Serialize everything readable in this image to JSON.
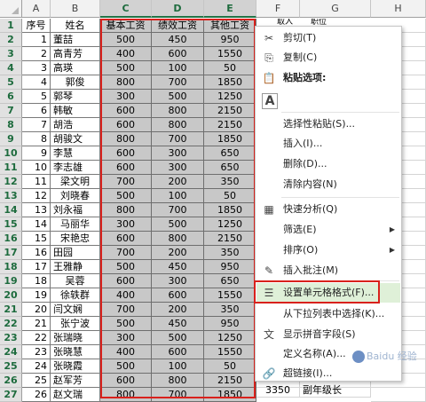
{
  "columns": [
    "A",
    "B",
    "C",
    "D",
    "E",
    "F",
    "G",
    "H"
  ],
  "headers": {
    "seq": "序号",
    "name": "姓名",
    "base": "基本工资",
    "perf": "绩效工资",
    "other": "其他工资"
  },
  "rows": [
    {
      "seq": "1",
      "name": "董喆",
      "base": "500",
      "perf": "450",
      "other": "950"
    },
    {
      "seq": "2",
      "name": "高青芳",
      "base": "400",
      "perf": "600",
      "other": "1550"
    },
    {
      "seq": "3",
      "name": "高瑛",
      "base": "500",
      "perf": "100",
      "other": "50"
    },
    {
      "seq": "4",
      "name": "郭俊",
      "base": "800",
      "perf": "700",
      "other": "1850"
    },
    {
      "seq": "5",
      "name": "郭琴",
      "base": "300",
      "perf": "500",
      "other": "1250"
    },
    {
      "seq": "6",
      "name": "韩敏",
      "base": "600",
      "perf": "800",
      "other": "2150"
    },
    {
      "seq": "7",
      "name": "胡浩",
      "base": "600",
      "perf": "800",
      "other": "2150"
    },
    {
      "seq": "8",
      "name": "胡骏文",
      "base": "800",
      "perf": "700",
      "other": "1850"
    },
    {
      "seq": "9",
      "name": "李慧",
      "base": "600",
      "perf": "300",
      "other": "650"
    },
    {
      "seq": "10",
      "name": "李志雄",
      "base": "600",
      "perf": "300",
      "other": "650"
    },
    {
      "seq": "11",
      "name": "梁文明",
      "base": "700",
      "perf": "200",
      "other": "350"
    },
    {
      "seq": "12",
      "name": "刘晓春",
      "base": "500",
      "perf": "100",
      "other": "50"
    },
    {
      "seq": "13",
      "name": "刘永福",
      "base": "800",
      "perf": "700",
      "other": "1850"
    },
    {
      "seq": "14",
      "name": "马丽华",
      "base": "300",
      "perf": "500",
      "other": "1250"
    },
    {
      "seq": "15",
      "name": "宋艳忠",
      "base": "600",
      "perf": "800",
      "other": "2150"
    },
    {
      "seq": "16",
      "name": "田园",
      "base": "700",
      "perf": "200",
      "other": "350"
    },
    {
      "seq": "17",
      "name": "王雅静",
      "base": "500",
      "perf": "450",
      "other": "950"
    },
    {
      "seq": "18",
      "name": "吴蓉",
      "base": "600",
      "perf": "300",
      "other": "650"
    },
    {
      "seq": "19",
      "name": "徐轶群",
      "base": "400",
      "perf": "600",
      "other": "1550"
    },
    {
      "seq": "20",
      "name": "闫文娴",
      "base": "700",
      "perf": "200",
      "other": "350"
    },
    {
      "seq": "21",
      "name": "张宁波",
      "base": "500",
      "perf": "450",
      "other": "950"
    },
    {
      "seq": "22",
      "name": "张瑞晓",
      "base": "300",
      "perf": "500",
      "other": "1250"
    },
    {
      "seq": "23",
      "name": "张晓慧",
      "base": "400",
      "perf": "600",
      "other": "1550"
    },
    {
      "seq": "24",
      "name": "张晓霞",
      "base": "500",
      "perf": "100",
      "other": "50"
    },
    {
      "seq": "25",
      "name": "赵军芳",
      "base": "600",
      "perf": "800",
      "other": "2150"
    },
    {
      "seq": "26",
      "name": "赵文瑞",
      "base": "800",
      "perf": "700",
      "other": "1850"
    }
  ],
  "partial_cells": {
    "f1": "取入",
    "g1": "职位",
    "f27": "3350",
    "g27": "副年级长"
  },
  "context_menu": {
    "items": [
      {
        "key": "cut",
        "label": "剪切(T)",
        "icon": "scissors-icon",
        "glyph": "✂"
      },
      {
        "key": "copy",
        "label": "复制(C)",
        "icon": "copy-icon",
        "glyph": "⎘"
      },
      {
        "key": "paste_options",
        "label": "粘贴选项:",
        "icon": "paste-icon",
        "glyph": "📋",
        "bold": true
      },
      {
        "key": "paste_a",
        "label": "",
        "icon": "paste-text-icon",
        "glyph": "A"
      },
      {
        "key": "paste_special",
        "label": "选择性粘贴(S)...",
        "icon": "",
        "glyph": ""
      },
      {
        "key": "insert",
        "label": "插入(I)...",
        "icon": "",
        "glyph": ""
      },
      {
        "key": "delete",
        "label": "删除(D)...",
        "icon": "",
        "glyph": ""
      },
      {
        "key": "clear",
        "label": "清除内容(N)",
        "icon": "",
        "glyph": ""
      },
      {
        "key": "quick_analysis",
        "label": "快速分析(Q)",
        "icon": "quick-analysis-icon",
        "glyph": "▦"
      },
      {
        "key": "filter",
        "label": "筛选(E)",
        "icon": "",
        "glyph": "",
        "submenu": true
      },
      {
        "key": "sort",
        "label": "排序(O)",
        "icon": "",
        "glyph": "",
        "submenu": true
      },
      {
        "key": "insert_comment",
        "label": "插入批注(M)",
        "icon": "comment-icon",
        "glyph": "✎"
      },
      {
        "key": "format_cells",
        "label": "设置单元格格式(F)...",
        "icon": "format-cells-icon",
        "glyph": "☰",
        "highlight": true
      },
      {
        "key": "pick_list",
        "label": "从下拉列表中选择(K)...",
        "icon": "",
        "glyph": ""
      },
      {
        "key": "phonetic",
        "label": "显示拼音字段(S)",
        "icon": "phonetic-icon",
        "glyph": "文"
      },
      {
        "key": "define_name",
        "label": "定义名称(A)...",
        "icon": "",
        "glyph": ""
      },
      {
        "key": "hyperlink",
        "label": "超链接(I)...",
        "icon": "hyperlink-icon",
        "glyph": "🔗"
      }
    ]
  },
  "watermark": "Baidu 经验",
  "colors": {
    "selection_border": "#d9211c",
    "excel_green": "#217346",
    "selected_fill": "#c8c8c8"
  }
}
